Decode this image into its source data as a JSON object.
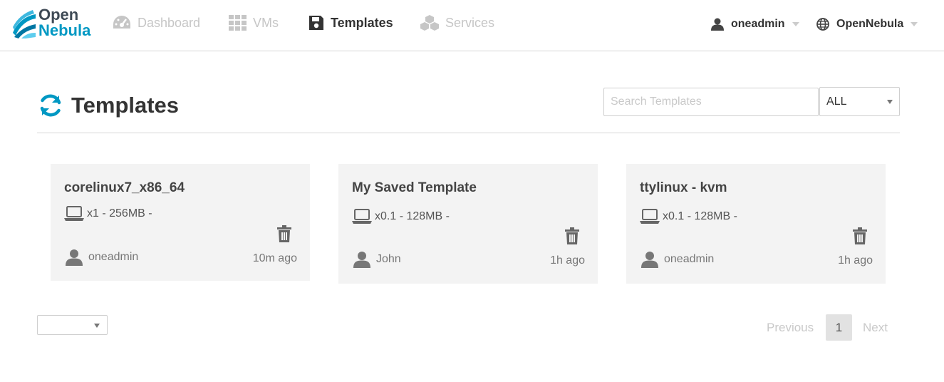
{
  "brand": {
    "line1": "Open",
    "line2": "Nebula"
  },
  "nav": [
    {
      "label": "Dashboard",
      "icon": "dashboard-gauge-icon",
      "active": false
    },
    {
      "label": "VMs",
      "icon": "grid-icon",
      "active": false
    },
    {
      "label": "Templates",
      "icon": "floppy-disk-icon",
      "active": true
    },
    {
      "label": "Services",
      "icon": "cubes-icon",
      "active": false
    }
  ],
  "user_menu": {
    "username": "oneadmin",
    "zone": "OpenNebula"
  },
  "page": {
    "title": "Templates",
    "search_placeholder": "Search Templates",
    "search_value": "",
    "filter_value": "ALL"
  },
  "templates": [
    {
      "name": "corelinux7_x86_64",
      "spec": "x1 - 256MB -",
      "owner": "oneadmin",
      "time": "10m ago"
    },
    {
      "name": "My Saved Template",
      "spec": "x0.1 - 128MB -",
      "owner": "John",
      "time": "1h ago"
    },
    {
      "name": "ttylinux - kvm",
      "spec": "x0.1 - 128MB -",
      "owner": "oneadmin",
      "time": "1h ago"
    }
  ],
  "pagination": {
    "previous": "Previous",
    "current": "1",
    "next": "Next",
    "page_size": ""
  },
  "colors": {
    "brand_blue": "#0098c3",
    "card_bg": "#f3f3f3",
    "inactive_nav": "#c6c6c6"
  }
}
